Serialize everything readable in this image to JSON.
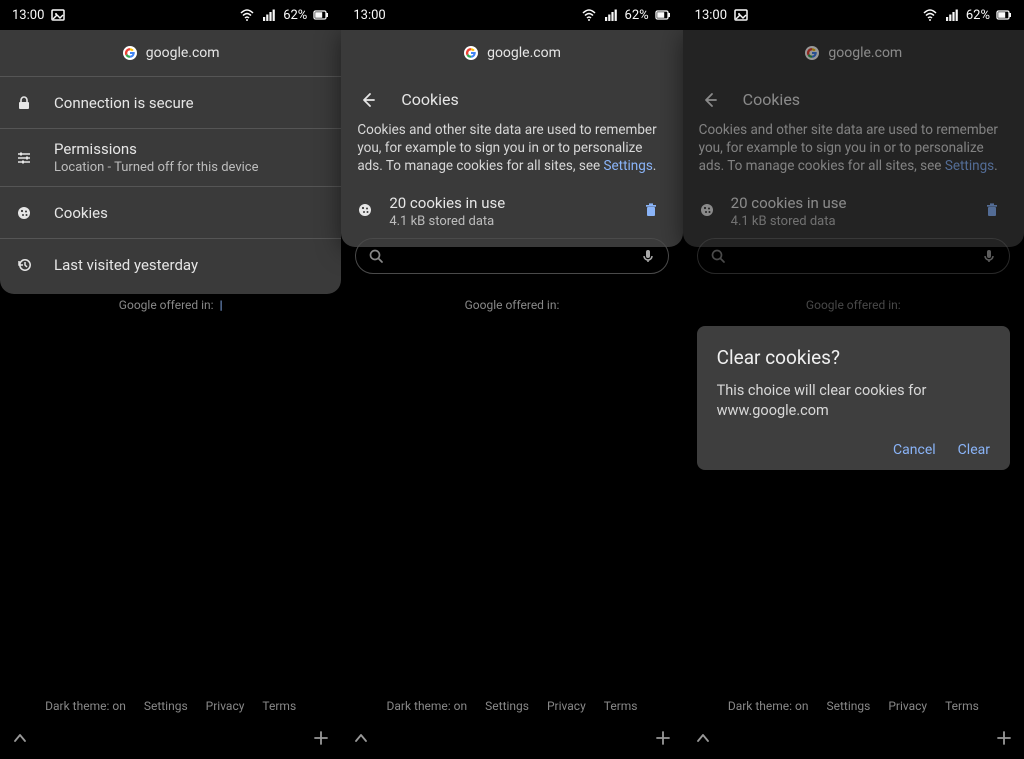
{
  "status": {
    "time": "13:00",
    "battery": "62%"
  },
  "site": {
    "domain": "google.com"
  },
  "pane1": {
    "rows": {
      "secure": "Connection is secure",
      "perm_title": "Permissions",
      "perm_sub": "Location - Turned off for this device",
      "cookies": "Cookies",
      "visited": "Last visited yesterday"
    },
    "offered": "Google offered in:"
  },
  "pane2": {
    "header": "Cookies",
    "desc_a": "Cookies and other site data are used to remember you, for example to sign you in or to personalize ads. To manage cookies for all sites, see ",
    "desc_link": "Settings",
    "desc_b": ".",
    "cookie_title": "20 cookies in use",
    "cookie_sub": "4.1 kB stored data",
    "offered": "Google offered in:"
  },
  "dialog": {
    "title": "Clear cookies?",
    "body": "This choice will clear cookies for www.google.com",
    "cancel": "Cancel",
    "clear": "Clear"
  },
  "footer": {
    "dark": "Dark theme: on",
    "settings": "Settings",
    "privacy": "Privacy",
    "terms": "Terms"
  }
}
